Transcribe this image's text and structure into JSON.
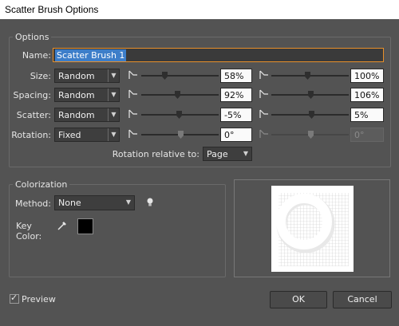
{
  "window": {
    "title": "Scatter Brush Options"
  },
  "options": {
    "group_label": "Options",
    "name": {
      "label": "Name:",
      "value": "Scatter Brush 1"
    },
    "rows": [
      {
        "label": "Size:",
        "mode": "Random",
        "min": "58%",
        "max": "100%",
        "min_level": 0.3,
        "max_level": 0.46,
        "disabled": false
      },
      {
        "label": "Spacing:",
        "mode": "Random",
        "min": "92%",
        "max": "106%",
        "min_level": 0.46,
        "max_level": 0.5,
        "disabled": false
      },
      {
        "label": "Scatter:",
        "mode": "Random",
        "min": "-5%",
        "max": "5%",
        "min_level": 0.48,
        "max_level": 0.52,
        "disabled": false
      },
      {
        "label": "Rotation:",
        "mode": "Fixed",
        "min": "0°",
        "max": "0°",
        "min_level": 0.5,
        "max_level": 0.5,
        "disabled": true
      }
    ],
    "rotation_relative": {
      "label": "Rotation relative to:",
      "value": "Page"
    }
  },
  "colorization": {
    "group_label": "Colorization",
    "method": {
      "label": "Method:",
      "value": "None"
    },
    "key_color": {
      "label": "Key Color:",
      "swatch": "#000000"
    },
    "tip_icon": "lightbulb-icon",
    "eyedropper_icon": "eyedropper-icon"
  },
  "preview_checkbox": {
    "label": "Preview",
    "checked": true
  },
  "buttons": {
    "ok": "OK",
    "cancel": "Cancel"
  },
  "colors": {
    "highlight": "#e8902a",
    "selection": "#3d7ec9"
  }
}
